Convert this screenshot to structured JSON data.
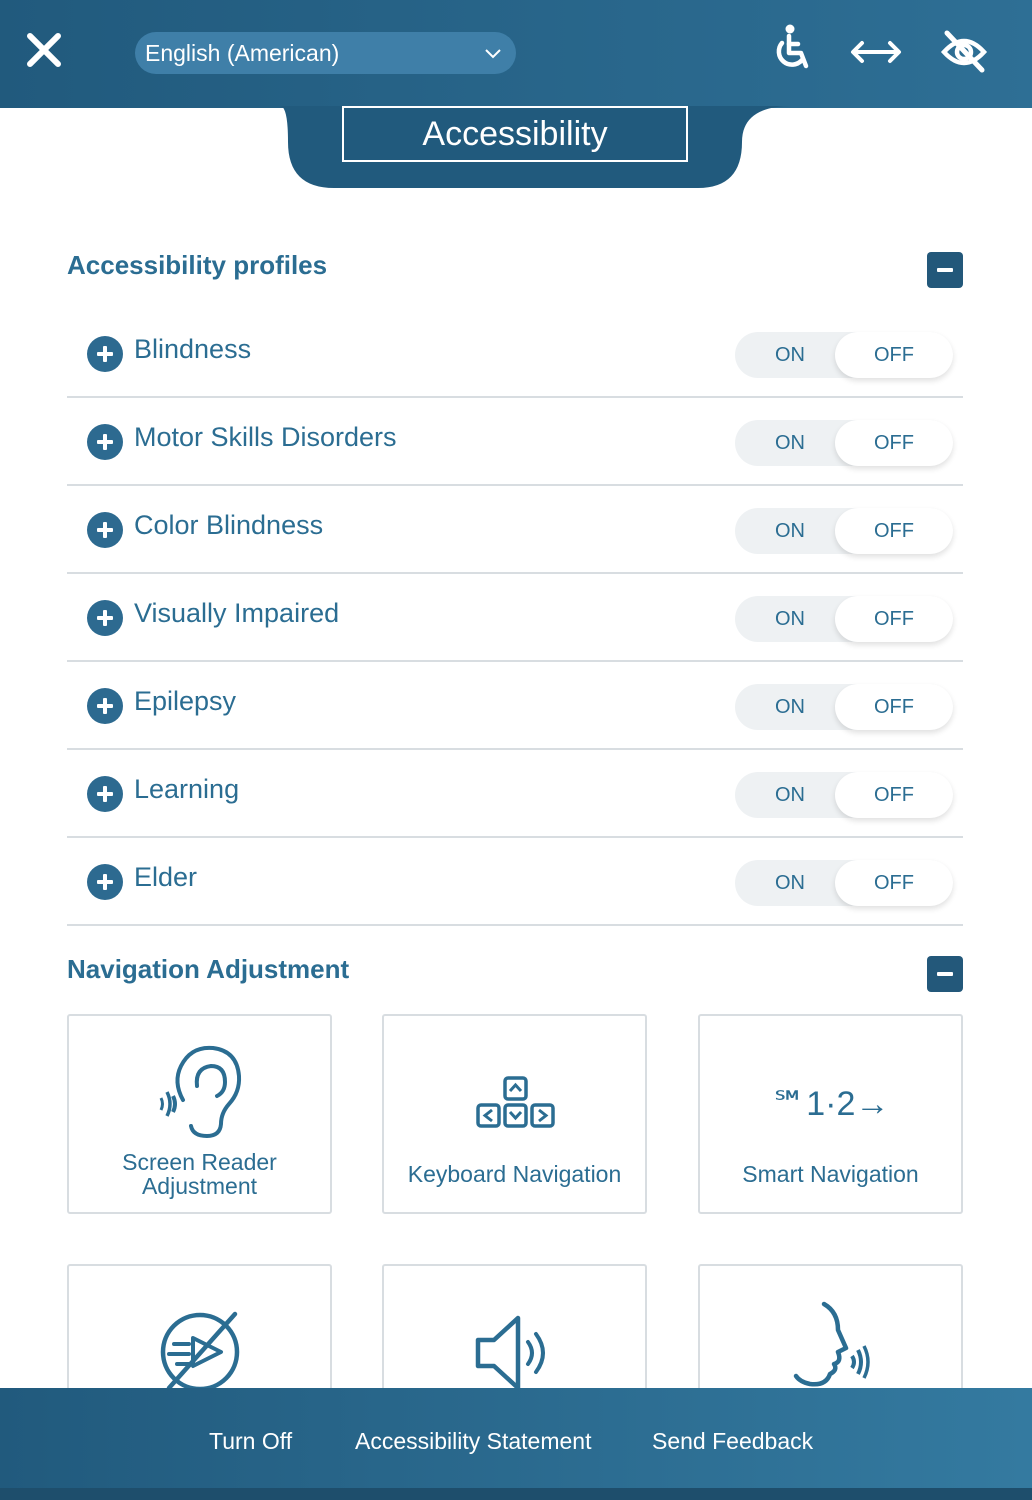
{
  "header": {
    "language": "English (American)",
    "title": "Accessibility",
    "icons": [
      "close-icon",
      "wheelchair-icon",
      "wide-view-icon",
      "hide-icon"
    ]
  },
  "profiles": {
    "title": "Accessibility profiles",
    "items": [
      {
        "label": "Blindness",
        "on": "ON",
        "off": "OFF"
      },
      {
        "label": "Motor Skills Disorders",
        "on": "ON",
        "off": "OFF"
      },
      {
        "label": "Color Blindness",
        "on": "ON",
        "off": "OFF"
      },
      {
        "label": "Visually Impaired",
        "on": "ON",
        "off": "OFF"
      },
      {
        "label": "Epilepsy",
        "on": "ON",
        "off": "OFF"
      },
      {
        "label": "Learning",
        "on": "ON",
        "off": "OFF"
      },
      {
        "label": "Elder",
        "on": "ON",
        "off": "OFF"
      }
    ]
  },
  "navigation": {
    "title": "Navigation Adjustment",
    "cards": [
      {
        "line1": "Screen Reader",
        "line2": "Adjustment",
        "icon": "ear-icon"
      },
      {
        "label": "Keyboard Navigation",
        "icon": "keyboard-arrows-icon"
      },
      {
        "label": "Smart Navigation",
        "icon": "smart-navigation-icon",
        "icon_text": "℠1·2→"
      },
      {
        "icon": "mute-icon"
      },
      {
        "icon": "speaker-icon"
      },
      {
        "icon": "voice-icon"
      }
    ]
  },
  "footer": {
    "turn_off": "Turn Off",
    "statement": "Accessibility Statement",
    "feedback": "Send Feedback"
  },
  "colors": {
    "header": "#215a7d",
    "accent": "#2b6d92",
    "divider": "#d8dde1"
  }
}
